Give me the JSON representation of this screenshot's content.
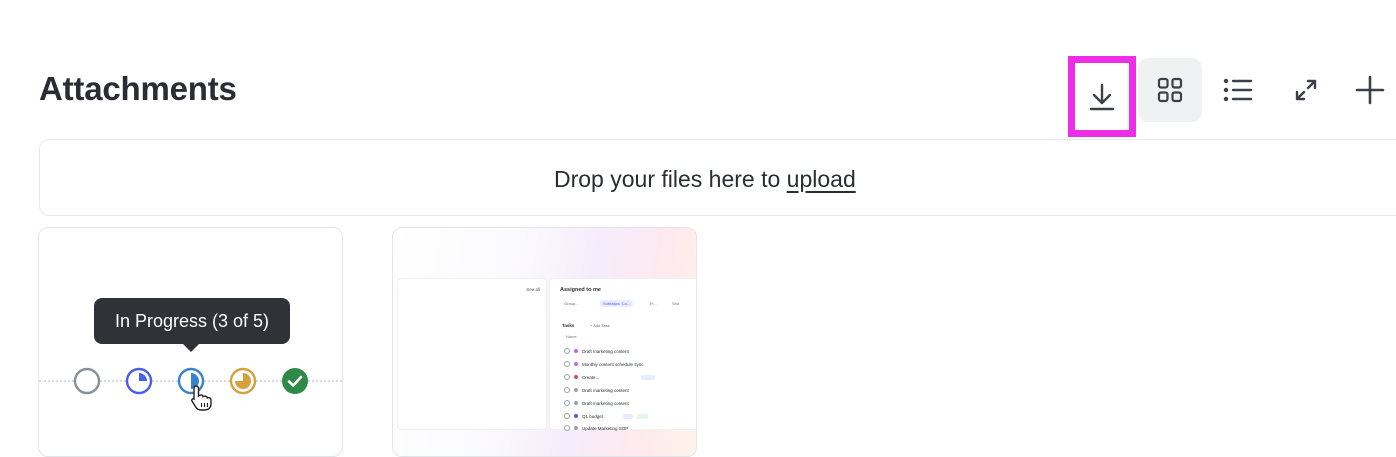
{
  "header": {
    "title": "Attachments"
  },
  "toolbar": {
    "download_icon": "download-icon",
    "grid_icon": "grid-view-icon",
    "list_icon": "list-view-icon",
    "expand_icon": "expand-icon",
    "add_icon": "plus-icon",
    "highlight_color": "#ee2ee6"
  },
  "dropzone": {
    "text": "Drop your files here to",
    "link": "upload"
  },
  "attachments": [
    {
      "tooltip": "In Progress (3 of 5)",
      "statuses": [
        "not-started",
        "quarter",
        "half",
        "three-quarter",
        "complete"
      ]
    },
    {
      "preview": {
        "see_all": "See all",
        "heading": "Assigned to me",
        "chips": [
          "Group...",
          "Subtasks: Co...",
          "Fi...",
          "Sho"
        ],
        "section": "Tasks",
        "add_task": "+ Add Task",
        "column": "Name",
        "tasks": [
          "Draft marketing content",
          "Monthly content schedule sync",
          "Create...",
          "Draft marketing content",
          "Draft marketing content",
          "Q1 budget",
          "Update Marketing SOP"
        ]
      }
    }
  ]
}
